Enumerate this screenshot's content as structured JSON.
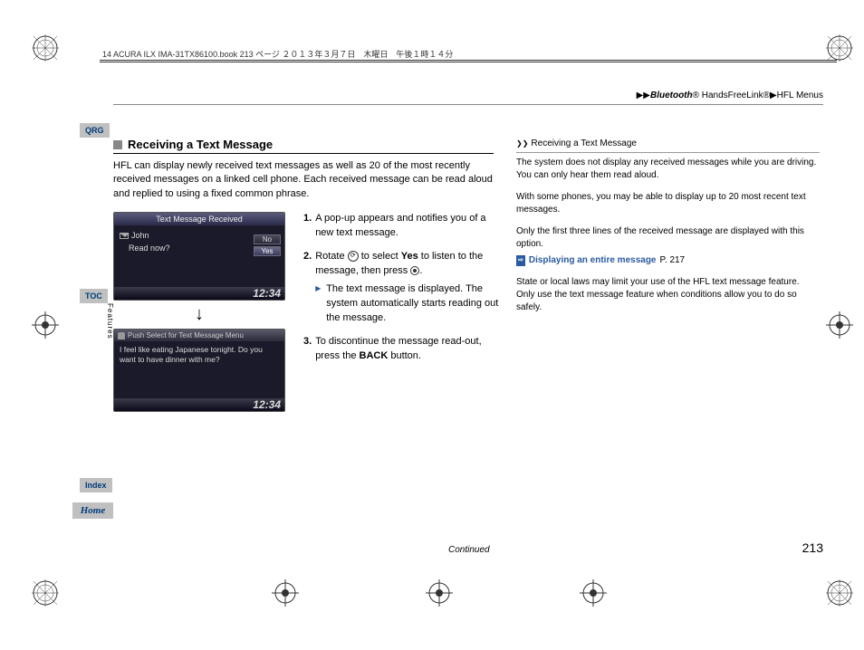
{
  "header": {
    "file_info": "14 ACURA ILX IMA-31TX86100.book  213 ページ  ２０１３年３月７日　木曜日　午後１時１４分"
  },
  "breadcrumb": {
    "arrow": "▶▶",
    "s1": "Bluetooth",
    "s1r": "®",
    "s2": " HandsFreeLink",
    "s2r": "®",
    "arrow2": "▶",
    "s3": "HFL Menus"
  },
  "sidetabs": {
    "qrg": "QRG",
    "toc": "TOC",
    "features": "Features",
    "index": "Index",
    "home": "Home"
  },
  "heading": "Receiving a Text Message",
  "intro": "HFL can display newly received text messages as well as 20 of the most recently received messages on a linked cell phone. Each received message can be read aloud and replied to using a fixed common phrase.",
  "screen1": {
    "title": "Text Message Received",
    "from": "John",
    "prompt": "Read now?",
    "opt_no": "No",
    "opt_yes": "Yes",
    "clock": "12:34"
  },
  "screen2": {
    "hint": "Push Select for Text Message Menu",
    "msg": "I feel like eating Japanese tonight. Do you want to have dinner with me?",
    "clock": "12:34"
  },
  "steps": {
    "s1n": "1.",
    "s1": "A pop-up appears and notifies you of a new text message.",
    "s2n": "2.",
    "s2a": "Rotate ",
    "s2b": " to select ",
    "s2yes": "Yes",
    "s2c": " to listen to the message, then press ",
    "s2d": ".",
    "s2sub": "The text message is displayed. The system automatically starts reading out the message.",
    "s3n": "3.",
    "s3a": "To discontinue the message read-out, press the ",
    "s3back": "BACK",
    "s3b": " button."
  },
  "right": {
    "head_icon": "❯❯",
    "head": "Receiving a Text Message",
    "p1": "The system does not display any received messages while you are driving. You can only hear them read aloud.",
    "p2": "With some phones, you may be able to display up to 20 most recent text messages.",
    "p3": "Only the first three lines of the received message are displayed with this option.",
    "link": "Displaying an entire message",
    "link_page": "P. 217",
    "p4": "State or local laws may limit your use of the HFL text message feature. Only use the text message feature when conditions allow you to do so safely."
  },
  "footer": {
    "continued": "Continued",
    "page": "213"
  }
}
